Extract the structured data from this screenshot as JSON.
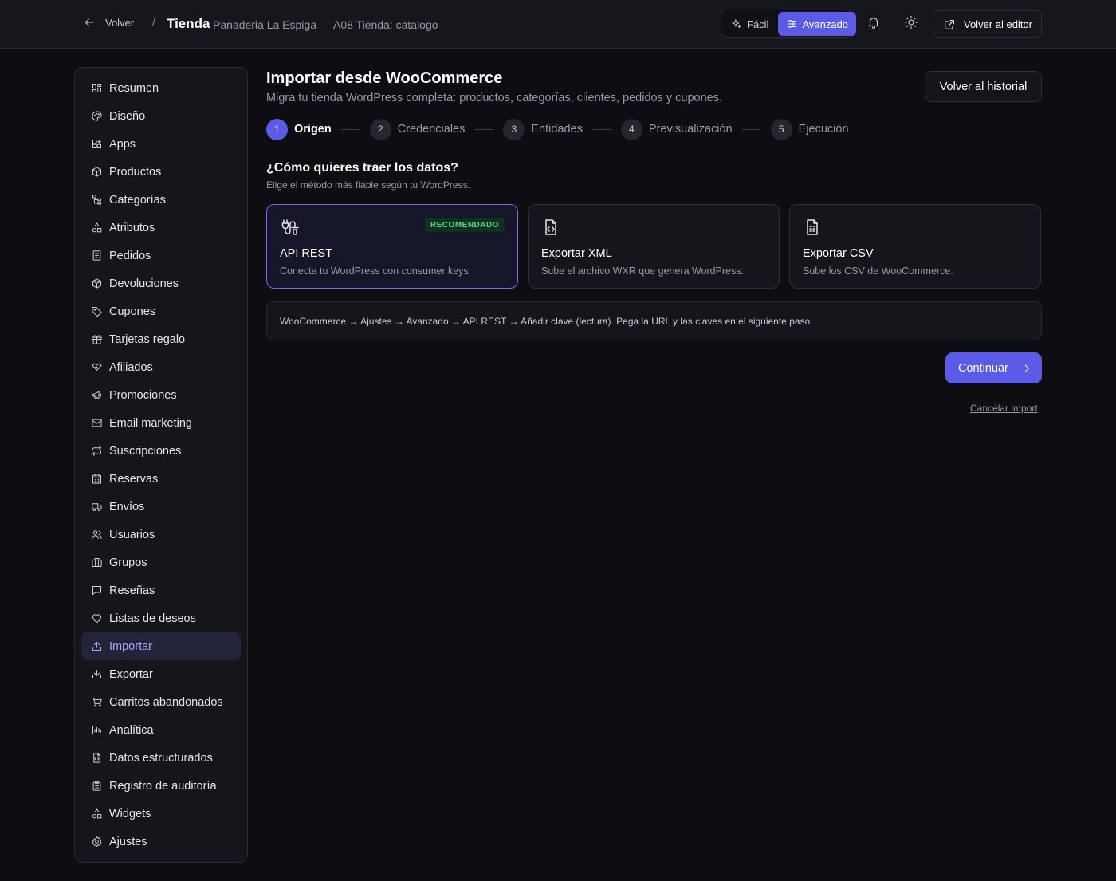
{
  "header": {
    "back_label": "Volver",
    "separator": "/",
    "brand": "Tienda",
    "subtitle": "Panaderia La Espiga — A08 Tienda: catalogo",
    "modes": [
      {
        "label": "Fácil",
        "icon": "sparkles-icon",
        "active": false
      },
      {
        "label": "Avanzado",
        "icon": "sliders-icon",
        "active": true
      }
    ],
    "notifications_icon": "bell-icon",
    "theme_icon": "sun-icon",
    "editor_label": "Volver al editor"
  },
  "sidebar": {
    "items": [
      {
        "label": "Resumen",
        "icon": "dashboard-icon"
      },
      {
        "label": "Diseño",
        "icon": "palette-icon"
      },
      {
        "label": "Apps",
        "icon": "apps-icon"
      },
      {
        "label": "Productos",
        "icon": "package-icon"
      },
      {
        "label": "Categorías",
        "icon": "tree-icon"
      },
      {
        "label": "Atributos",
        "icon": "shapes-icon"
      },
      {
        "label": "Pedidos",
        "icon": "receipt-icon"
      },
      {
        "label": "Devoluciones",
        "icon": "package-return-icon"
      },
      {
        "label": "Cupones",
        "icon": "tag-icon"
      },
      {
        "label": "Tarjetas regalo",
        "icon": "gift-icon"
      },
      {
        "label": "Afiliados",
        "icon": "handshake-icon"
      },
      {
        "label": "Promociones",
        "icon": "megaphone-icon"
      },
      {
        "label": "Email marketing",
        "icon": "mail-icon"
      },
      {
        "label": "Suscripciones",
        "icon": "repeat-icon"
      },
      {
        "label": "Reservas",
        "icon": "calendar-icon"
      },
      {
        "label": "Envíos",
        "icon": "truck-icon"
      },
      {
        "label": "Usuarios",
        "icon": "users-icon"
      },
      {
        "label": "Grupos",
        "icon": "groups-icon"
      },
      {
        "label": "Reseñas",
        "icon": "message-icon"
      },
      {
        "label": "Listas de deseos",
        "icon": "heart-icon"
      },
      {
        "label": "Importar",
        "icon": "upload-icon",
        "active": true
      },
      {
        "label": "Exportar",
        "icon": "download-icon"
      },
      {
        "label": "Carritos abandonados",
        "icon": "cart-icon"
      },
      {
        "label": "Analítica",
        "icon": "bar-chart-icon"
      },
      {
        "label": "Datos estructurados",
        "icon": "file-code-icon"
      },
      {
        "label": "Registro de auditoría",
        "icon": "clipboard-icon"
      },
      {
        "label": "Widgets",
        "icon": "widgets-icon"
      },
      {
        "label": "Ajustes",
        "icon": "gear-icon"
      }
    ]
  },
  "main": {
    "title": "Importar desde WooCommerce",
    "subtitle": "Migra tu tienda WordPress completa: productos, categorías, clientes, pedidos y cupones.",
    "history_label": "Volver al historial",
    "steps": [
      {
        "num": "1",
        "label": "Origen",
        "active": true
      },
      {
        "num": "2",
        "label": "Credenciales"
      },
      {
        "num": "3",
        "label": "Entidades"
      },
      {
        "num": "4",
        "label": "Previsualización"
      },
      {
        "num": "5",
        "label": "Ejecución"
      }
    ],
    "question": "¿Cómo quieres traer los datos?",
    "question_sub": "Elige el método más fiable según tu WordPress.",
    "methods": [
      {
        "title": "API REST",
        "desc": "Conecta tu WordPress con consumer keys.",
        "badge": "RECOMENDADO",
        "icon": "plug-icon",
        "selected": true
      },
      {
        "title": "Exportar XML",
        "desc": "Sube el archivo WXR que genera WordPress.",
        "icon": "file-code-icon"
      },
      {
        "title": "Exportar CSV",
        "desc": "Sube los CSV de WooCommerce.",
        "icon": "file-spreadsheet-icon"
      }
    ],
    "info": "WooCommerce → Ajustes → Avanzado → API REST → Añadir clave (lectura). Pega la URL y las claves en el siguiente paso.",
    "continue_label": "Continuar",
    "cancel_label": "Cancelar import"
  },
  "colors": {
    "accent": "#5b5be8",
    "background": "#0d0d12",
    "badge_green": "#4fd48a"
  }
}
